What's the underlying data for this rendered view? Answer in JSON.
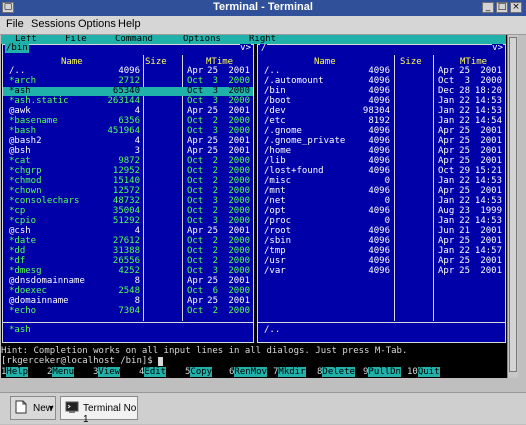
{
  "window": {
    "title": "Terminal - Terminal",
    "winmenu_icon": "▢",
    "min_icon": "_",
    "max_icon": "□",
    "close_icon": "×"
  },
  "menubar": [
    "File",
    "Sessions",
    "Options",
    "Help"
  ],
  "mc_menu": [
    "Left",
    "File",
    "Command",
    "Options",
    "Right"
  ],
  "left_panel": {
    "path": "/bin",
    "corner": "v>",
    "headers": {
      "name": "Name",
      "size": "Size",
      "mtime": "MTime"
    },
    "rows": [
      {
        "name": "/..",
        "size": "4096",
        "month": "Apr",
        "day": "25",
        "time": "2001",
        "exe": false,
        "sel": false
      },
      {
        "name": "*arch",
        "size": "2712",
        "month": "Oct",
        "day": "3",
        "time": "2000",
        "exe": true,
        "sel": false
      },
      {
        "name": "*ash",
        "size": "65340",
        "month": "Oct",
        "day": "3",
        "time": "2000",
        "exe": true,
        "sel": true
      },
      {
        "name": "*ash.static",
        "size": "263144",
        "month": "Oct",
        "day": "3",
        "time": "2000",
        "exe": true,
        "sel": false
      },
      {
        "name": "@awk",
        "size": "4",
        "month": "Apr",
        "day": "25",
        "time": "2001",
        "exe": false,
        "sel": false
      },
      {
        "name": "*basename",
        "size": "6356",
        "month": "Oct",
        "day": "2",
        "time": "2000",
        "exe": true,
        "sel": false
      },
      {
        "name": "*bash",
        "size": "451964",
        "month": "Oct",
        "day": "3",
        "time": "2000",
        "exe": true,
        "sel": false
      },
      {
        "name": "@bash2",
        "size": "4",
        "month": "Apr",
        "day": "25",
        "time": "2001",
        "exe": false,
        "sel": false
      },
      {
        "name": "@bsh",
        "size": "3",
        "month": "Apr",
        "day": "25",
        "time": "2001",
        "exe": false,
        "sel": false
      },
      {
        "name": "*cat",
        "size": "9872",
        "month": "Oct",
        "day": "2",
        "time": "2000",
        "exe": true,
        "sel": false
      },
      {
        "name": "*chgrp",
        "size": "12952",
        "month": "Oct",
        "day": "2",
        "time": "2000",
        "exe": true,
        "sel": false
      },
      {
        "name": "*chmod",
        "size": "15140",
        "month": "Oct",
        "day": "2",
        "time": "2000",
        "exe": true,
        "sel": false
      },
      {
        "name": "*chown",
        "size": "12572",
        "month": "Oct",
        "day": "2",
        "time": "2000",
        "exe": true,
        "sel": false
      },
      {
        "name": "*consolechars",
        "size": "48732",
        "month": "Oct",
        "day": "3",
        "time": "2000",
        "exe": true,
        "sel": false
      },
      {
        "name": "*cp",
        "size": "35004",
        "month": "Oct",
        "day": "2",
        "time": "2000",
        "exe": true,
        "sel": false
      },
      {
        "name": "*cpio",
        "size": "51292",
        "month": "Oct",
        "day": "3",
        "time": "2000",
        "exe": true,
        "sel": false
      },
      {
        "name": "@csh",
        "size": "4",
        "month": "Apr",
        "day": "25",
        "time": "2001",
        "exe": false,
        "sel": false
      },
      {
        "name": "*date",
        "size": "27612",
        "month": "Oct",
        "day": "2",
        "time": "2000",
        "exe": true,
        "sel": false
      },
      {
        "name": "*dd",
        "size": "31388",
        "month": "Oct",
        "day": "2",
        "time": "2000",
        "exe": true,
        "sel": false
      },
      {
        "name": "*df",
        "size": "26556",
        "month": "Oct",
        "day": "2",
        "time": "2000",
        "exe": true,
        "sel": false
      },
      {
        "name": "*dmesg",
        "size": "4252",
        "month": "Oct",
        "day": "3",
        "time": "2000",
        "exe": true,
        "sel": false
      },
      {
        "name": "@dnsdomainname",
        "size": "8",
        "month": "Apr",
        "day": "25",
        "time": "2001",
        "exe": false,
        "sel": false
      },
      {
        "name": "*doexec",
        "size": "2548",
        "month": "Oct",
        "day": "6",
        "time": "2000",
        "exe": true,
        "sel": false
      },
      {
        "name": "@domainname",
        "size": "8",
        "month": "Apr",
        "day": "25",
        "time": "2001",
        "exe": false,
        "sel": false
      },
      {
        "name": "*echo",
        "size": "7304",
        "month": "Oct",
        "day": "2",
        "time": "2000",
        "exe": true,
        "sel": false
      }
    ],
    "mini_status": "*ash"
  },
  "right_panel": {
    "path": "/",
    "corner": "v>",
    "headers": {
      "name": "Name",
      "size": "Size",
      "mtime": "MTime"
    },
    "rows": [
      {
        "name": "/..",
        "size": "4096",
        "month": "Apr",
        "day": "25",
        "time": "2001"
      },
      {
        "name": "/.automount",
        "size": "4096",
        "month": "Oct",
        "day": "3",
        "time": "2000"
      },
      {
        "name": "/bin",
        "size": "4096",
        "month": "Dec",
        "day": "28",
        "time": "18:20"
      },
      {
        "name": "/boot",
        "size": "4096",
        "month": "Jan",
        "day": "22",
        "time": "14:53"
      },
      {
        "name": "/dev",
        "size": "98304",
        "month": "Jan",
        "day": "22",
        "time": "14:53"
      },
      {
        "name": "/etc",
        "size": "8192",
        "month": "Jan",
        "day": "22",
        "time": "14:54"
      },
      {
        "name": "/.gnome",
        "size": "4096",
        "month": "Apr",
        "day": "25",
        "time": "2001"
      },
      {
        "name": "/.gnome_private",
        "size": "4096",
        "month": "Apr",
        "day": "25",
        "time": "2001"
      },
      {
        "name": "/home",
        "size": "4096",
        "month": "Apr",
        "day": "25",
        "time": "2001"
      },
      {
        "name": "/lib",
        "size": "4096",
        "month": "Apr",
        "day": "25",
        "time": "2001"
      },
      {
        "name": "/lost+found",
        "size": "4096",
        "month": "Oct",
        "day": "29",
        "time": "15:21"
      },
      {
        "name": "/misc",
        "size": "0",
        "month": "Jan",
        "day": "22",
        "time": "14:53"
      },
      {
        "name": "/mnt",
        "size": "4096",
        "month": "Apr",
        "day": "25",
        "time": "2001"
      },
      {
        "name": "/net",
        "size": "0",
        "month": "Jan",
        "day": "22",
        "time": "14:53"
      },
      {
        "name": "/opt",
        "size": "4096",
        "month": "Aug",
        "day": "23",
        "time": "1999"
      },
      {
        "name": "/proc",
        "size": "0",
        "month": "Jan",
        "day": "22",
        "time": "14:53"
      },
      {
        "name": "/root",
        "size": "4096",
        "month": "Jun",
        "day": "21",
        "time": "2001"
      },
      {
        "name": "/sbin",
        "size": "4096",
        "month": "Apr",
        "day": "25",
        "time": "2001"
      },
      {
        "name": "/tmp",
        "size": "4096",
        "month": "Jan",
        "day": "22",
        "time": "14:57"
      },
      {
        "name": "/usr",
        "size": "4096",
        "month": "Apr",
        "day": "25",
        "time": "2001"
      },
      {
        "name": "/var",
        "size": "4096",
        "month": "Apr",
        "day": "25",
        "time": "2001"
      }
    ],
    "mini_status": "/.."
  },
  "hint": "Hint: Completion works on all input lines in all dialogs. Just press M-Tab.",
  "prompt": "[rkgerceker@localhost /bin]$ ",
  "fkeys": [
    {
      "num": "1",
      "label": "Help"
    },
    {
      "num": "2",
      "label": "Menu"
    },
    {
      "num": "3",
      "label": "View"
    },
    {
      "num": "4",
      "label": "Edit"
    },
    {
      "num": "5",
      "label": "Copy"
    },
    {
      "num": "6",
      "label": "RenMov"
    },
    {
      "num": "7",
      "label": "Mkdir"
    },
    {
      "num": "8",
      "label": "Delete"
    },
    {
      "num": "9",
      "label": "PullDn"
    },
    {
      "num": "10",
      "label": "Quit"
    }
  ],
  "taskbar": {
    "new_label": "New",
    "terminal_tab_label": "Terminal No 1"
  },
  "colors": {
    "panel_bg": "#0000a8",
    "accent_cyan": "#20b2aa",
    "exe_green": "#55ff55",
    "header_yellow": "#ffff55",
    "title_blue": "#30509a"
  }
}
